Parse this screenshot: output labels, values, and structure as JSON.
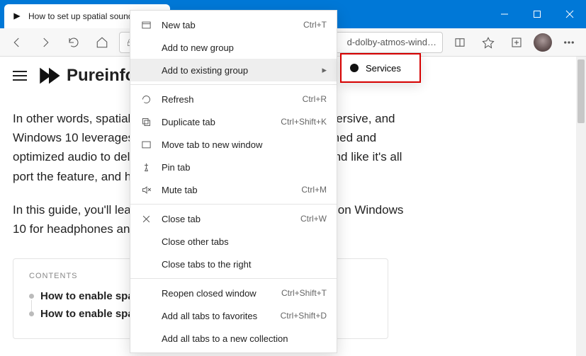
{
  "window": {
    "tab_title": "How to set up spatial sound wi…",
    "url_text": "d-dolby-atmos-wind…"
  },
  "brand": {
    "name": "Pureinfote"
  },
  "article": {
    "p1": "In other words, spatial sound is a new format for a more immersive, and Windows 10 leverages this format along with specially designed and optimized audio to deliver a listening experience making sound like it's all port the feature, and headphones.",
    "p2": "In this guide, you'll learn the steps to configure spatial sound on Windows 10 for headphones and home theater."
  },
  "toc": {
    "title": "CONTENTS",
    "items": [
      "How to enable spatial sound for headphones",
      "How to enable spatial sound for home theater"
    ]
  },
  "ctx": {
    "new_tab": "New tab",
    "new_tab_k": "Ctrl+T",
    "add_new_group": "Add to new group",
    "add_existing": "Add to existing group",
    "refresh": "Refresh",
    "refresh_k": "Ctrl+R",
    "duplicate": "Duplicate tab",
    "duplicate_k": "Ctrl+Shift+K",
    "move_window": "Move tab to new window",
    "pin": "Pin tab",
    "mute": "Mute tab",
    "mute_k": "Ctrl+M",
    "close": "Close tab",
    "close_k": "Ctrl+W",
    "close_other": "Close other tabs",
    "close_right": "Close tabs to the right",
    "reopen": "Reopen closed window",
    "reopen_k": "Ctrl+Shift+T",
    "add_fav": "Add all tabs to favorites",
    "add_fav_k": "Ctrl+Shift+D",
    "add_coll": "Add all tabs to a new collection"
  },
  "submenu": {
    "services": "Services"
  }
}
